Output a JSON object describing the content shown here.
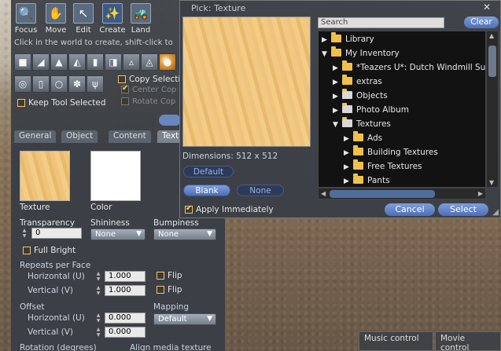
{
  "build": {
    "tools": [
      {
        "label": "Focus",
        "icon": "🔍"
      },
      {
        "label": "Move",
        "icon": "✋"
      },
      {
        "label": "Edit",
        "icon": "↖"
      },
      {
        "label": "Create",
        "icon": "✨"
      },
      {
        "label": "Land",
        "icon": "🚜"
      }
    ],
    "hint": "Click in the world to create, shift-click to",
    "copy_selection": "Copy Selection",
    "center_copy": "Center Cop",
    "rotate_copy": "Rotate Cop",
    "keep_tool": "Keep Tool Selected",
    "tabs": [
      "General",
      "Object",
      "Content",
      "Textu"
    ],
    "texture_label": "Texture",
    "color_label": "Color",
    "transparency_label": "Transparency",
    "transparency_value": "0",
    "shininess_label": "Shininess",
    "shininess_value": "None",
    "bumpiness_label": "Bumpiness",
    "bumpiness_value": "None",
    "full_bright": "Full Bright",
    "repeats_label": "Repeats per Face",
    "horizontal_label": "Horizontal (U)",
    "horizontal_value": "1.000",
    "vertical_label": "Vertical (V)",
    "vertical_value": "1.000",
    "flip_label": "Flip",
    "offset_label": "Offset",
    "offset_h_label": "Horizontal (U)",
    "offset_h_value": "0.000",
    "offset_v_label": "Vertical (V)",
    "offset_v_value": "0.000",
    "mapping_label": "Mapping",
    "mapping_value": "Default",
    "rotation_label": "Rotation (degrees)",
    "align_media": "Align media texture"
  },
  "picker": {
    "title": "Pick: Texture",
    "dimensions": "Dimensions: 512 x 512",
    "default_btn": "Default",
    "blank_btn": "Blank",
    "none_btn": "None",
    "apply_immediately": "Apply Immediately",
    "search_placeholder": "Search",
    "clear_btn": "Clear",
    "tree": [
      {
        "label": "Library",
        "indent": 0,
        "arrow": "▶",
        "kind": "folder"
      },
      {
        "label": "My Inventory",
        "indent": 0,
        "arrow": "▼",
        "kind": "folder"
      },
      {
        "label": "*Teazers U*: Dutch Windmill Supp",
        "indent": 1,
        "arrow": "▶",
        "kind": "folder"
      },
      {
        "label": "extras",
        "indent": 1,
        "arrow": "▶",
        "kind": "folder"
      },
      {
        "label": "Objects",
        "indent": 1,
        "arrow": "▶",
        "kind": "special"
      },
      {
        "label": "Photo Album",
        "indent": 1,
        "arrow": "▶",
        "kind": "special"
      },
      {
        "label": "Textures",
        "indent": 1,
        "arrow": "▼",
        "kind": "special"
      },
      {
        "label": "Ads",
        "indent": 2,
        "arrow": "▶",
        "kind": "folder"
      },
      {
        "label": "Building Textures",
        "indent": 2,
        "arrow": "▶",
        "kind": "folder"
      },
      {
        "label": "Free Textures",
        "indent": 2,
        "arrow": "▶",
        "kind": "folder"
      },
      {
        "label": "Pants",
        "indent": 2,
        "arrow": "▶",
        "kind": "folder"
      }
    ],
    "cancel_btn": "Cancel",
    "select_btn": "Select"
  },
  "media": {
    "music": "Music control",
    "movie": "Movie control"
  }
}
